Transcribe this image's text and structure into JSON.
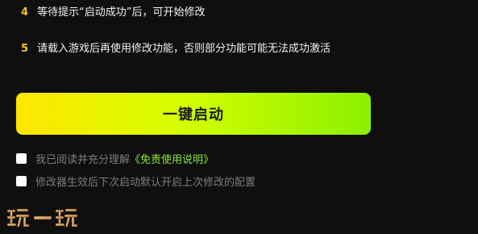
{
  "steps": [
    {
      "number": "4",
      "text": "等待提示“启动成功”后，可开始修改"
    },
    {
      "number": "5",
      "text": "请载入游戏后再使用修改功能，否则部分功能可能无法成功激活"
    }
  ],
  "start_button": {
    "label": "一键启动"
  },
  "options": [
    {
      "prefix": "我已阅读并充分理解",
      "link": "《免责使用说明》"
    },
    {
      "prefix": "修改器生效后下次启动默认开启上次修改的配置",
      "link": ""
    }
  ],
  "watermark": {
    "text": "玩一玩"
  },
  "colors": {
    "background": "#0f0f0f",
    "step_number": "#f5c518",
    "button_gradient_start": "#ffe600",
    "button_gradient_end": "#8cf000",
    "link": "#8ee63c",
    "muted_text": "#7d7d7d"
  }
}
